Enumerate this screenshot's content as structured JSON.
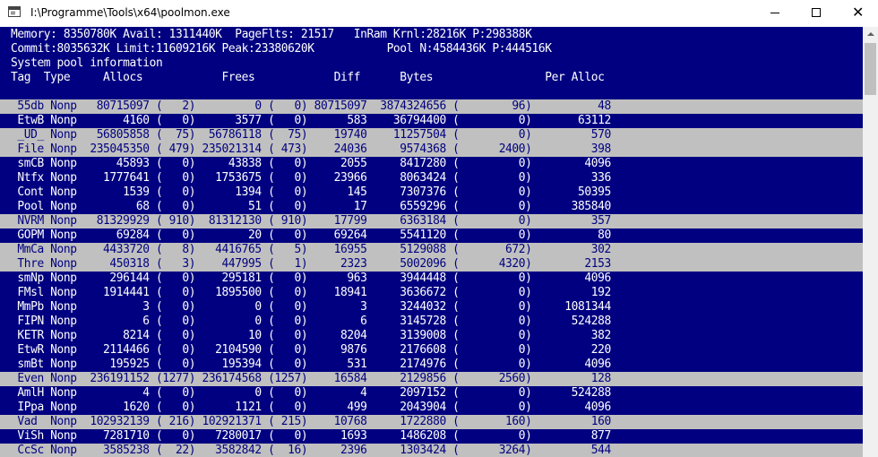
{
  "window": {
    "title": "I:\\Programme\\Tools\\x64\\poolmon.exe"
  },
  "header": [
    "Memory: 8350780K Avail: 1311440K  PageFlts: 21517   InRam Krnl:28216K P:298388K",
    "Commit:8035632K Limit:11609216K Peak:23380620K           Pool N:4584436K P:444516K",
    "System pool information",
    "Tag  Type     Allocs            Frees            Diff      Bytes                 Per Alloc"
  ],
  "rows": [
    {
      "text": " 55db Nonp   80715097 (   2)         0 (   0) 80715097  3874324656 (        96)          48",
      "hl": true
    },
    {
      "text": " EtwB Nonp       4160 (   0)      3577 (   0)      583    36794400 (         0)       63112",
      "hl": false
    },
    {
      "text": " _UD_ Nonp   56805858 (  75)  56786118 (  75)    19740    11257504 (         0)         570",
      "hl": true
    },
    {
      "text": " File Nonp  235045350 ( 479) 235021314 ( 473)    24036     9574368 (      2400)         398",
      "hl": true
    },
    {
      "text": " smCB Nonp      45893 (   0)     43838 (   0)     2055     8417280 (         0)        4096",
      "hl": false
    },
    {
      "text": " Ntfx Nonp    1777641 (   0)   1753675 (   0)    23966     8063424 (         0)         336",
      "hl": false
    },
    {
      "text": " Cont Nonp       1539 (   0)      1394 (   0)      145     7307376 (         0)       50395",
      "hl": false
    },
    {
      "text": " Pool Nonp         68 (   0)        51 (   0)       17     6559296 (         0)      385840",
      "hl": false
    },
    {
      "text": " NVRM Nonp   81329929 ( 910)  81312130 ( 910)    17799     6363184 (         0)         357",
      "hl": true
    },
    {
      "text": " GOPM Nonp      69284 (   0)        20 (   0)    69264     5541120 (         0)          80",
      "hl": false
    },
    {
      "text": " MmCa Nonp    4433720 (   8)   4416765 (   5)    16955     5129088 (       672)         302",
      "hl": true
    },
    {
      "text": " Thre Nonp     450318 (   3)    447995 (   1)     2323     5002096 (      4320)        2153",
      "hl": true
    },
    {
      "text": " smNp Nonp     296144 (   0)    295181 (   0)      963     3944448 (         0)        4096",
      "hl": false
    },
    {
      "text": " FMsl Nonp    1914441 (   0)   1895500 (   0)    18941     3636672 (         0)         192",
      "hl": false
    },
    {
      "text": " MmPb Nonp          3 (   0)         0 (   0)        3     3244032 (         0)     1081344",
      "hl": false
    },
    {
      "text": " FIPN Nonp          6 (   0)         0 (   0)        6     3145728 (         0)      524288",
      "hl": false
    },
    {
      "text": " KETR Nonp       8214 (   0)        10 (   0)     8204     3139008 (         0)         382",
      "hl": false
    },
    {
      "text": " EtwR Nonp    2114466 (   0)   2104590 (   0)     9876     2176608 (         0)         220",
      "hl": false
    },
    {
      "text": " smBt Nonp     195925 (   0)    195394 (   0)      531     2174976 (         0)        4096",
      "hl": false
    },
    {
      "text": " Even Nonp  236191152 (1277) 236174568 (1257)    16584     2129856 (      2560)         128",
      "hl": true
    },
    {
      "text": " AmlH Nonp          4 (   0)         0 (   0)        4     2097152 (         0)      524288",
      "hl": false
    },
    {
      "text": " IPpa Nonp       1620 (   0)      1121 (   0)      499     2043904 (         0)        4096",
      "hl": false
    },
    {
      "text": " Vad  Nonp  102932139 ( 216) 102921371 ( 215)    10768     1722880 (       160)         160",
      "hl": true
    },
    {
      "text": " ViSh Nonp    7281710 (   0)   7280017 (   0)     1693     1486208 (         0)         877",
      "hl": false
    },
    {
      "text": " CcSc Nonp    3585238 (  22)   3582842 (  16)     2396     1303424 (      3264)         544",
      "hl": true
    }
  ],
  "colors": {
    "console_bg": "#000080",
    "console_fg": "#ffffff",
    "highlight_bg": "#c0c0c0",
    "highlight_fg": "#000080"
  },
  "icons": {
    "app": "console-window-icon",
    "minimize": "minimize-icon",
    "maximize": "maximize-icon",
    "close": "close-icon",
    "scroll_up": "scroll-up-arrow-icon"
  }
}
